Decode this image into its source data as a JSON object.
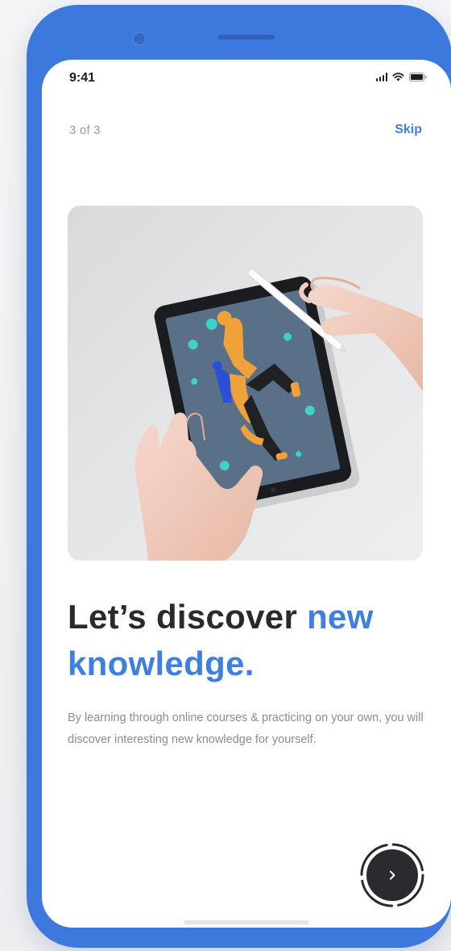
{
  "status_bar": {
    "time": "9:41"
  },
  "onboarding": {
    "progress_text": "3 of 3",
    "skip_label": "Skip",
    "headline_part1": "Let’s discover ",
    "headline_part2": "new knowledge.",
    "description": "By learning through online courses & practicing on your own, you will discover interesting new knowledge for yourself."
  },
  "icons": {
    "signal": "signal-icon",
    "wifi": "wifi-icon",
    "battery": "battery-icon",
    "next": "chevron-right-icon"
  },
  "colors": {
    "phone_frame": "#3d78dc",
    "accent": "#3f7fe0",
    "headline": "#2a2a2d",
    "body_text": "#8c8c8c",
    "next_button": "#2b2b2f"
  }
}
